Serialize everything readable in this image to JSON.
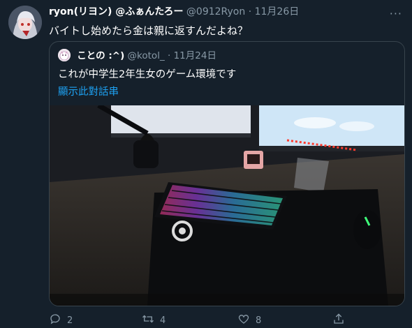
{
  "tweet": {
    "display_name": "ryon(リヨン) @ふぁんたろー",
    "handle": "@0912Ryon",
    "separator": "·",
    "date": "11月26日",
    "text": "バイトし始めたら金は親に返すんだよね？",
    "more_icon": "more-horizontal-icon"
  },
  "quoted": {
    "display_name": "ことの :^)",
    "handle": "@kotol_",
    "separator": "·",
    "date": "11月24日",
    "text": "これが中学生2年生女のゲーム環境です",
    "thread_link": "顯示此對話串",
    "photo_subject": "desk-setup-rgb-keyboard-photo"
  },
  "actions": {
    "reply_count": "2",
    "retweet_count": "4",
    "like_count": "8"
  },
  "colors": {
    "background": "#15202b",
    "secondary_text": "#8899a6",
    "link": "#1da1f2",
    "border": "#38444d"
  }
}
